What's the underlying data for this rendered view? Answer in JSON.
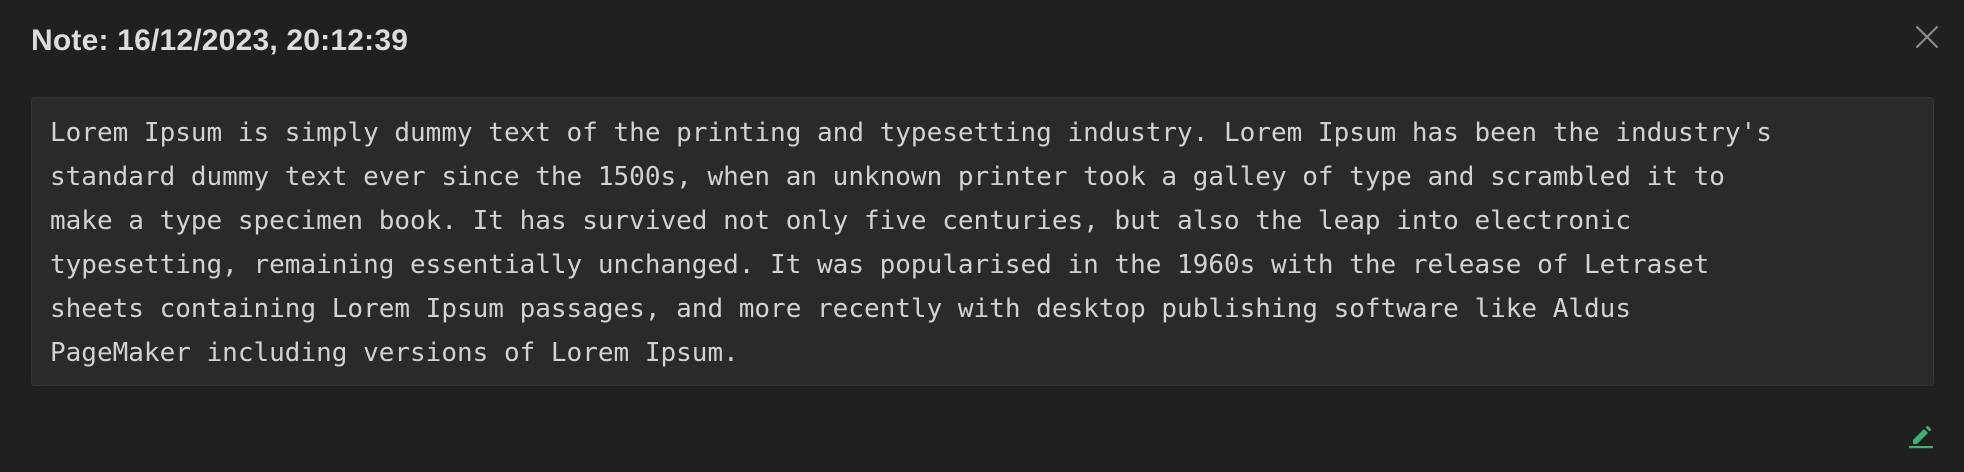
{
  "dialog": {
    "title": "Note: 16/12/2023, 20:12:39",
    "note_text": "Lorem Ipsum is simply dummy text of the printing and typesetting industry. Lorem Ipsum has been the industry's\nstandard dummy text ever since the 1500s, when an unknown printer took a galley of type and scrambled it to\nmake a type specimen book. It has survived not only five centuries, but also the leap into electronic\ntypesetting, remaining essentially unchanged. It was popularised in the 1960s with the release of Letraset\nsheets containing Lorem Ipsum passages, and more recently with desktop publishing software like Aldus\nPageMaker including versions of Lorem Ipsum.",
    "close_icon": "close-icon",
    "edit_icon": "pencil-icon"
  },
  "colors": {
    "background": "#202020",
    "text_area_bg": "#2a2a2a",
    "title": "#dcdcdc",
    "body_text": "#d2d2d2",
    "close_icon": "#8a8a8a",
    "accent_edit": "#3cb371"
  }
}
